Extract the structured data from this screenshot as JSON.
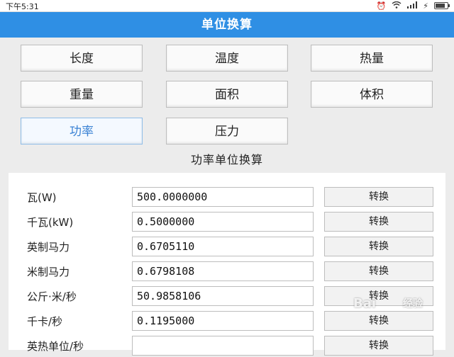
{
  "status_bar": {
    "time": "下午5:31",
    "icons": [
      "alarm-icon",
      "wifi-icon",
      "signal-icon",
      "charging-icon",
      "battery-icon"
    ]
  },
  "title": "单位换算",
  "categories": [
    {
      "label": "长度"
    },
    {
      "label": "温度"
    },
    {
      "label": "热量"
    },
    {
      "label": "重量"
    },
    {
      "label": "面积"
    },
    {
      "label": "体积"
    },
    {
      "label": "功率",
      "active": true
    },
    {
      "label": "压力"
    }
  ],
  "section_title": "功率单位换算",
  "convert_label": "转换",
  "rows": [
    {
      "unit": "瓦(W)",
      "value": "500.0000000"
    },
    {
      "unit": "千瓦(kW)",
      "value": "0.5000000"
    },
    {
      "unit": "英制马力",
      "value": "0.6705110"
    },
    {
      "unit": "米制马力",
      "value": "0.6798108"
    },
    {
      "unit": "公斤·米/秒",
      "value": "50.9858106"
    },
    {
      "unit": "千卡/秒",
      "value": "0.1195000"
    },
    {
      "unit": "英热单位/秒",
      "value": ""
    }
  ],
  "watermark": {
    "text": "Bai",
    "suffix": "经验"
  },
  "colors": {
    "title_bar": "#2f8fe4",
    "active_tab": "#3a82d4"
  }
}
